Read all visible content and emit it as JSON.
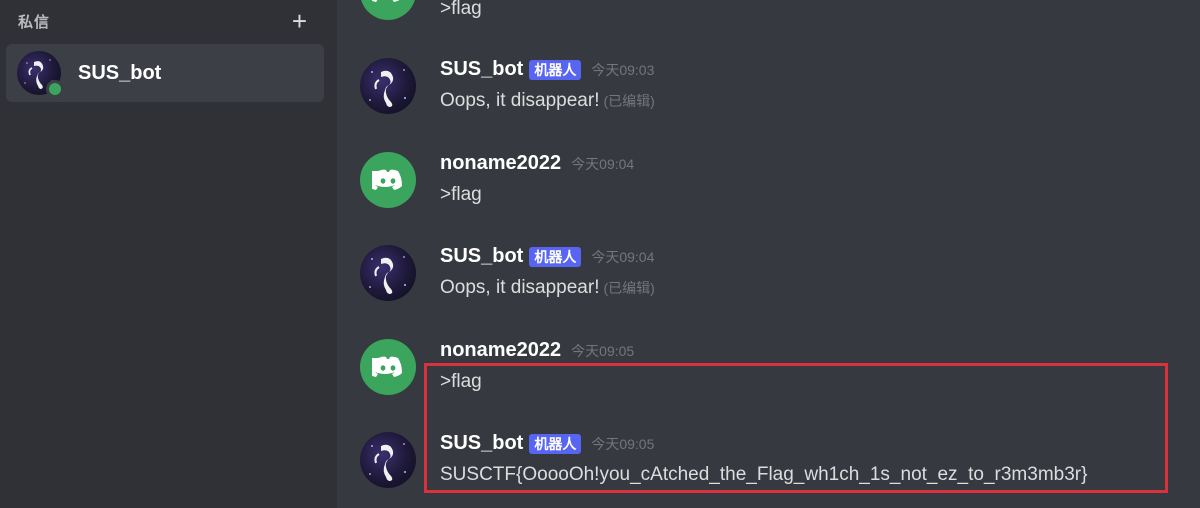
{
  "sidebar": {
    "title": "私信",
    "add_symbol": "+",
    "dm": {
      "name": "SUS_bot",
      "status": "online"
    }
  },
  "messages": [
    {
      "body": ">flag"
    },
    {
      "author": "SUS_bot",
      "bot_tag": "机器人",
      "time": "今天09:03",
      "body": "Oops, it disappear!",
      "edited": "(已编辑)"
    },
    {
      "author": "noname2022",
      "time": "今天09:04",
      "body": ">flag"
    },
    {
      "author": "SUS_bot",
      "bot_tag": "机器人",
      "time": "今天09:04",
      "body": "Oops, it disappear!",
      "edited": "(已编辑)"
    },
    {
      "author": "noname2022",
      "time": "今天09:05",
      "body": ">flag"
    },
    {
      "author": "SUS_bot",
      "bot_tag": "机器人",
      "time": "今天09:05",
      "body": "SUSCTF{OoooOh!you_cAtched_the_Flag_wh1ch_1s_not_ez_to_r3m3mb3r}"
    }
  ],
  "colors": {
    "sidebar_bg": "#2f3136",
    "chat_bg": "#36393f",
    "accent": "#5865f2",
    "online": "#3ba55d",
    "highlight_border": "#d9323c"
  }
}
